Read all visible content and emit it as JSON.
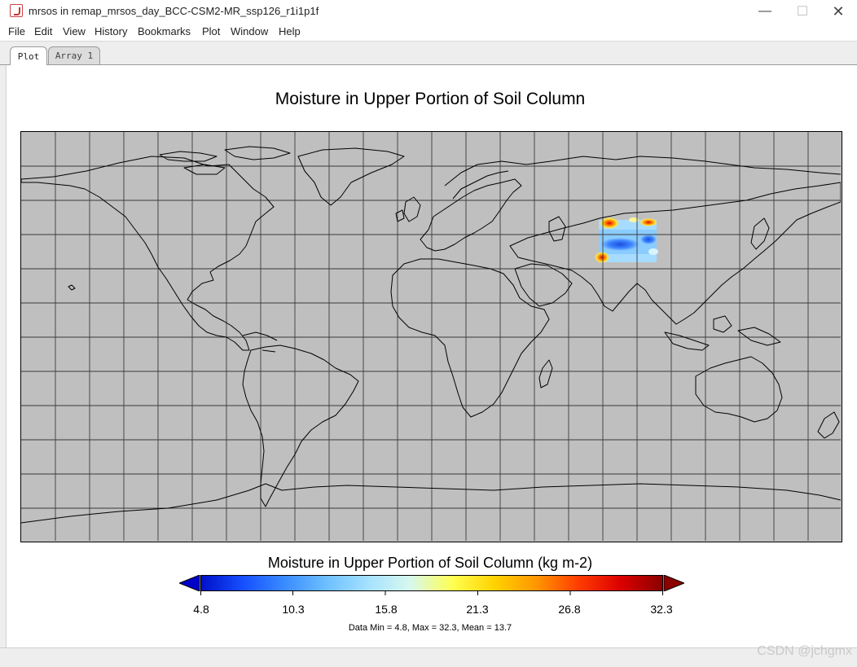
{
  "window": {
    "title": "mrsos in remap_mrsos_day_BCC-CSM2-MR_ssp126_r1i1p1f",
    "app_icon": "java-cup-icon"
  },
  "menu": [
    "File",
    "Edit",
    "View",
    "History",
    "Bookmarks",
    "Plot",
    "Window",
    "Help"
  ],
  "tabs": [
    {
      "label": "Plot",
      "active": true
    },
    {
      "label": "Array 1",
      "active": false
    }
  ],
  "plot": {
    "title": "Moisture in Upper Portion of Soil Column",
    "map": {
      "projection": "equirectangular world map",
      "background_color": "#bfbfbf",
      "grid": true,
      "coastlines": true,
      "data_region": "Central Asia data patch"
    },
    "colorbar": {
      "title": "Moisture in Upper Portion of Soil Column (kg m-2)",
      "min_arrow_color": "#0000c8",
      "max_arrow_color": "#8c0000",
      "colors": [
        "#0010c8",
        "#1550ff",
        "#3a8cff",
        "#6ec0ff",
        "#a6e2ff",
        "#d8f8ec",
        "#ffff50",
        "#ffd200",
        "#ff9600",
        "#ff3c00",
        "#dc0000",
        "#8c0000"
      ],
      "ticks": [
        "4.8",
        "10.3",
        "15.8",
        "21.3",
        "26.8",
        "32.3"
      ]
    },
    "stats": "Data Min = 4.8, Max = 32.3, Mean = 13.7"
  },
  "watermark": "CSDN @jchgmx"
}
